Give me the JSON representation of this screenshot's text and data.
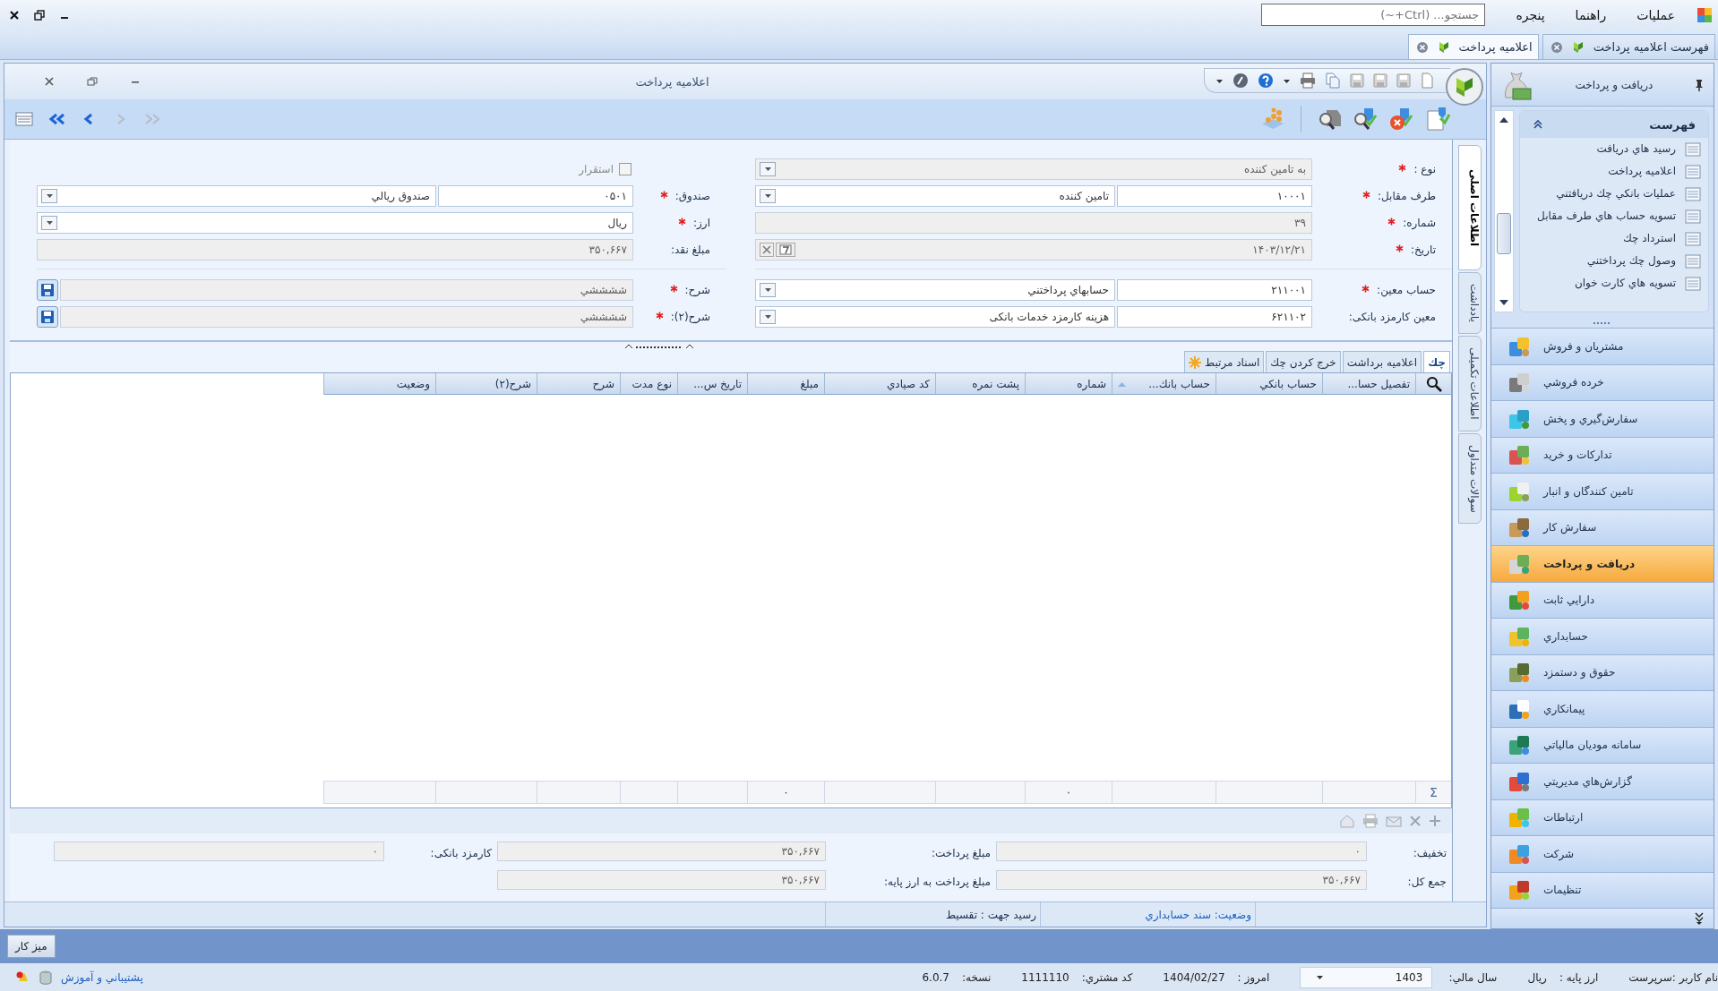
{
  "menu": {
    "items": [
      "عملیات",
      "راهنما",
      "پنجره"
    ],
    "search": {
      "placeholder": "جستجو... (Ctrl+~)"
    }
  },
  "doc_tabs": [
    {
      "label": "فهرست اعلامیه پرداخت",
      "selected": false
    },
    {
      "label": "اعلامیه پرداخت",
      "selected": true
    }
  ],
  "window": {
    "title": "اعلامیه پرداخت"
  },
  "side_tabs": [
    {
      "label": "اطلاعات اصلی",
      "selected": true
    },
    {
      "label": "یادداشت",
      "selected": false
    },
    {
      "label": "اطلاعات تکمیلی",
      "selected": false
    },
    {
      "label": "سوالات متداول",
      "selected": false
    }
  ],
  "form": {
    "columns": [
      {
        "groups": [
          [
            {
              "kind": "combo",
              "label": "نوع :",
              "required": true,
              "value": "به تامین کننده",
              "disabled": true
            },
            {
              "kind": "pair",
              "label": "طرف مقابل:",
              "required": true,
              "code": "۱۰۰۰۱",
              "value": "تامین کننده",
              "disabled": false
            },
            {
              "kind": "text",
              "label": "شماره:",
              "required": true,
              "value": "۳۹",
              "disabled": true
            },
            {
              "kind": "date",
              "label": "تاریخ:",
              "required": true,
              "value": "۱۴۰۳/۱۲/۲۱",
              "disabled": true
            }
          ],
          [
            {
              "kind": "pair",
              "label": "حساب معین:",
              "required": true,
              "code": "۲۱۱۰۰۱",
              "value": "حسابهاي پرداختني",
              "disabled": false
            },
            {
              "kind": "pair",
              "label": "معین کارمزد بانکی:",
              "required": false,
              "code": "۶۲۱۱۰۲",
              "value": "هزینه کارمزد خدمات بانکی",
              "disabled": false
            }
          ]
        ]
      },
      {
        "groups": [
          [
            {
              "kind": "check",
              "text": "استقرار",
              "checked": false,
              "disabled": true
            },
            {
              "kind": "pair",
              "label": "صندوق:",
              "required": true,
              "code": "۰۵۰۱",
              "value": "صندوق ريالي",
              "disabled": false
            },
            {
              "kind": "combo",
              "label": "ارز:",
              "required": true,
              "value": "ريال",
              "disabled": false
            },
            {
              "kind": "text",
              "label": "مبلغ نقد:",
              "required": false,
              "value": "۳۵۰,۶۶۷",
              "disabled": true
            }
          ],
          [
            {
              "kind": "note",
              "label": "شرح:",
              "required": true,
              "value": "ششششي",
              "disabled": true
            },
            {
              "kind": "note",
              "label": "شرح(۲):",
              "required": true,
              "value": "ششششي",
              "disabled": true
            }
          ]
        ]
      }
    ]
  },
  "grid": {
    "tabs": [
      {
        "label": "چك",
        "selected": true
      },
      {
        "label": "اعلامیه برداشت",
        "selected": false
      },
      {
        "label": "خرج کردن چك",
        "selected": false
      },
      {
        "label": "اسناد مرتبط",
        "selected": false
      }
    ],
    "sum_symbol": "Σ",
    "columns": [
      {
        "label": "تفصیل حسا...",
        "sorted": false
      },
      {
        "label": "حساب بانکي",
        "sorted": false
      },
      {
        "label": "حساب بانك...",
        "sorted": true
      },
      {
        "label": "شماره",
        "sorted": false,
        "footer": "۰"
      },
      {
        "label": "پشت نمره",
        "sorted": false
      },
      {
        "label": "کد صیادي",
        "sorted": false
      },
      {
        "label": "مبلغ",
        "sorted": false,
        "footer": "۰"
      },
      {
        "label": "تاریخ س...",
        "sorted": false
      },
      {
        "label": "نوع مدت",
        "sorted": false
      },
      {
        "label": "شرح",
        "sorted": false
      },
      {
        "label": "شرح(۲)",
        "sorted": false
      },
      {
        "label": "وضعیت",
        "sorted": false
      }
    ]
  },
  "totals": {
    "rows": [
      [
        {
          "label": "تخفیف:",
          "value": "۰"
        },
        {
          "label": "مبلغ پرداخت:",
          "value": "۳۵۰,۶۶۷"
        },
        {
          "label": "کارمزد بانکی:",
          "value": "۰"
        }
      ],
      [
        {
          "label": "جمع کل:",
          "value": "۳۵۰,۶۶۷"
        },
        {
          "label": "مبلغ پرداخت به ارز پایه:",
          "value": "۳۵۰,۶۶۷"
        }
      ]
    ]
  },
  "window_status": [
    {
      "kind": "link",
      "text": "وضعیت: سند حسابداري"
    },
    {
      "kind": "plain",
      "text": "رسید جهت : تقسیط"
    }
  ],
  "sidebar": {
    "title": "دريافت و پرداخت",
    "group": {
      "title": "فهرست",
      "expanded": true,
      "items": [
        "رسید هاي دریافت",
        "اعلامیه پرداخت",
        "عملیات بانکي چك دریافتني",
        "تسویه حساب هاي طرف مقابل",
        "استرداد چك",
        "وصول چك پرداختني",
        "تسویه هاي کارت خوان"
      ]
    },
    "modules": [
      {
        "label": "مشتريان و فروش",
        "selected": false
      },
      {
        "label": "خرده فروشي",
        "selected": false
      },
      {
        "label": "سفارش‌گيري و پخش",
        "selected": false
      },
      {
        "label": "تدارکات و خريد",
        "selected": false
      },
      {
        "label": "تامين کنندگان و انبار",
        "selected": false
      },
      {
        "label": "سفارش کار",
        "selected": false
      },
      {
        "label": "دريافت و پرداخت",
        "selected": true
      },
      {
        "label": "دارايي ثابت",
        "selected": false
      },
      {
        "label": "حسابداري",
        "selected": false
      },
      {
        "label": "حقوق و دستمزد",
        "selected": false
      },
      {
        "label": "پيمانکاري",
        "selected": false
      },
      {
        "label": "سامانه موديان مالياتي",
        "selected": false
      },
      {
        "label": "گزارش‌هاي مديريتي",
        "selected": false
      },
      {
        "label": "ارتباطات",
        "selected": false
      },
      {
        "label": "شرکت",
        "selected": false
      },
      {
        "label": "تنظيمات",
        "selected": false
      }
    ]
  },
  "desktop": {
    "button": "میز کار"
  },
  "status_bar": {
    "items": [
      {
        "kind": "label",
        "text": "نام کاربر :سرپرست"
      },
      {
        "kind": "label",
        "text": "ارز پایه :"
      },
      {
        "kind": "value",
        "text": "ريال"
      },
      {
        "kind": "label",
        "text": "سال مالي:"
      },
      {
        "kind": "combo",
        "text": "1403"
      },
      {
        "kind": "label",
        "text": "امروز :"
      },
      {
        "kind": "value",
        "text": "1404/02/27"
      },
      {
        "kind": "label",
        "text": "کد مشتري:"
      },
      {
        "kind": "value",
        "text": "1111110"
      },
      {
        "kind": "label",
        "text": "نسخه:"
      },
      {
        "kind": "value",
        "text": "6.0.7"
      }
    ],
    "link": "پشتيباني و آموزش"
  }
}
